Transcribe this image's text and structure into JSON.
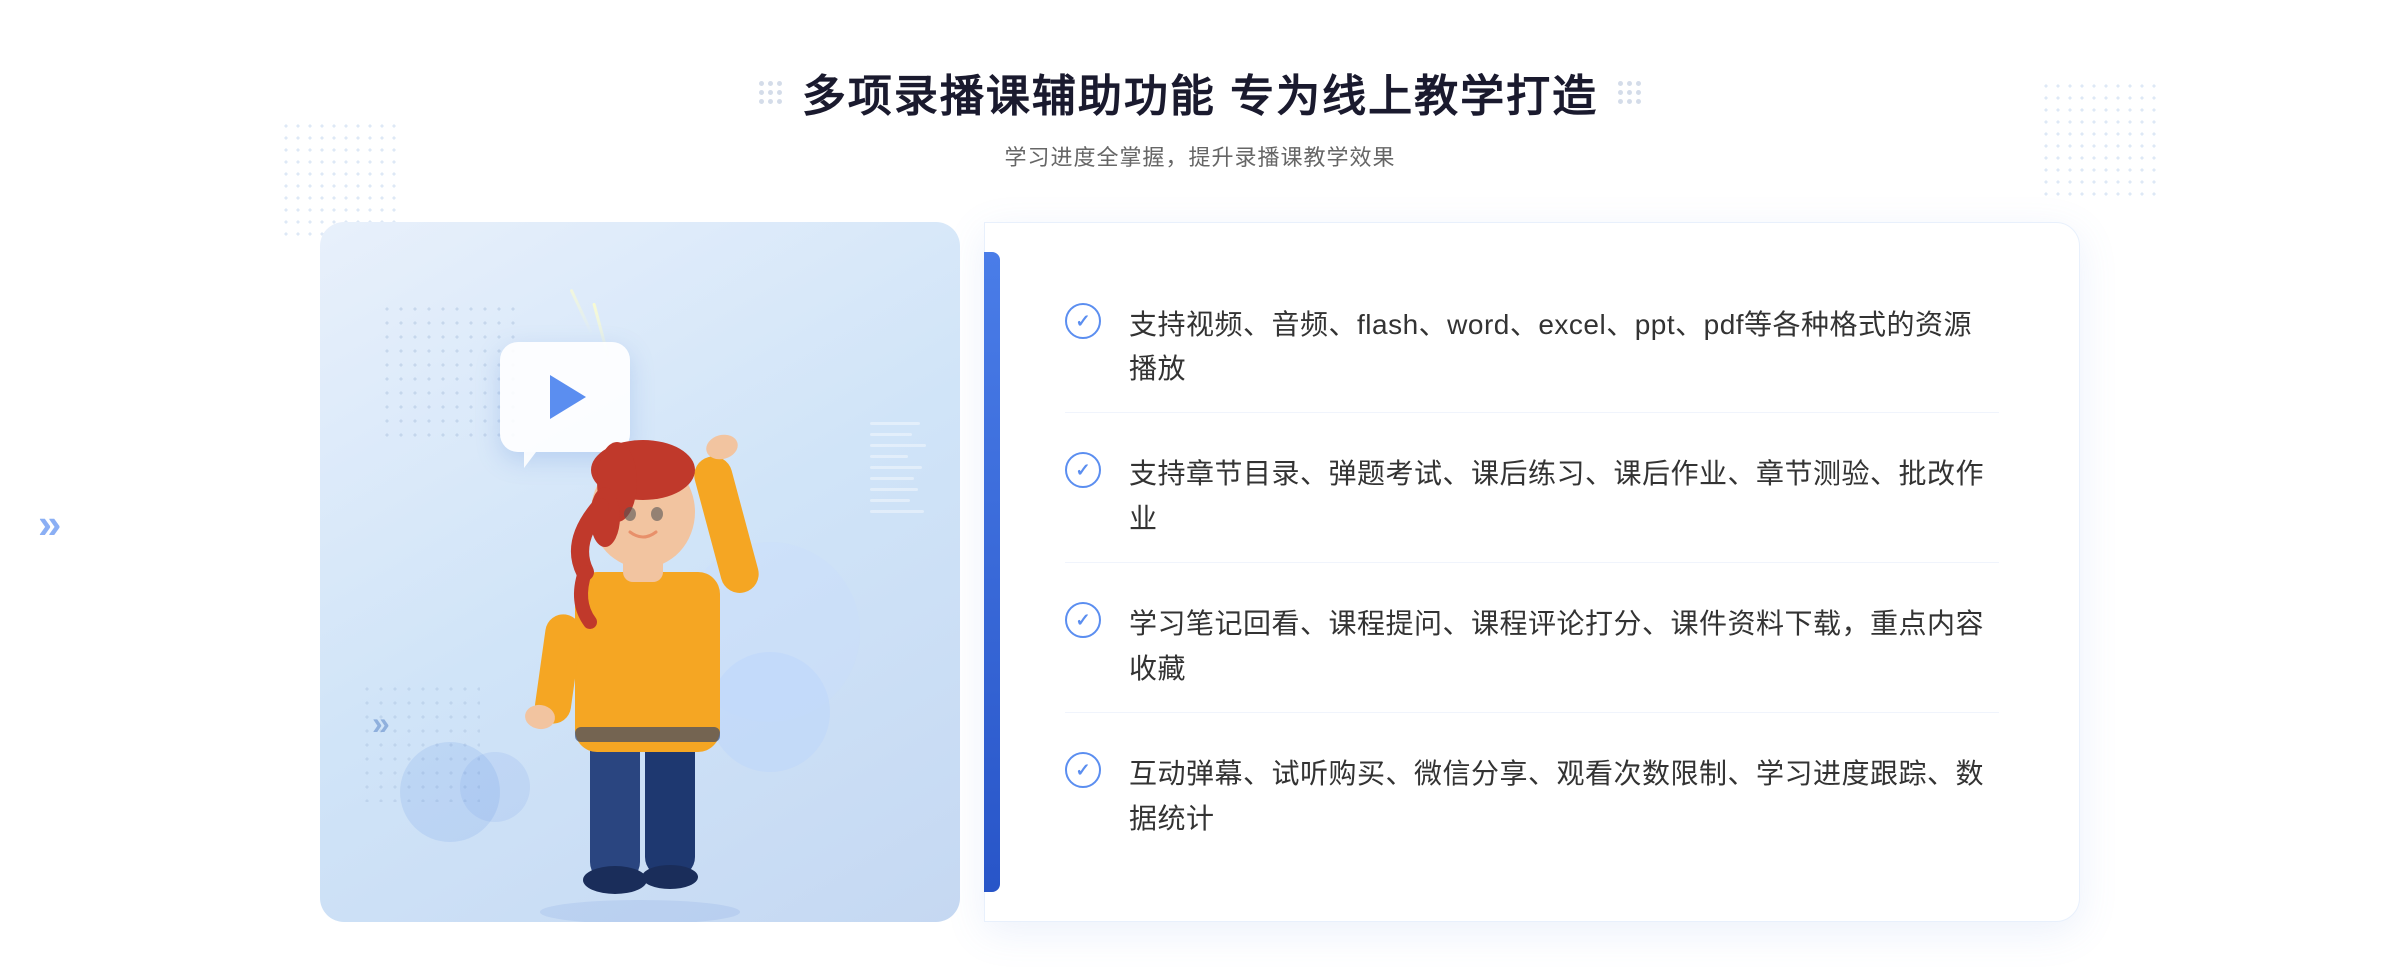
{
  "header": {
    "title": "多项录播课辅助功能 专为线上教学打造",
    "subtitle": "学习进度全掌握，提升录播课教学效果"
  },
  "features": [
    {
      "id": "feature-1",
      "text": "支持视频、音频、flash、word、excel、ppt、pdf等各种格式的资源播放"
    },
    {
      "id": "feature-2",
      "text": "支持章节目录、弹题考试、课后练习、课后作业、章节测验、批改作业"
    },
    {
      "id": "feature-3",
      "text": "学习笔记回看、课程提问、课程评论打分、课件资料下载，重点内容收藏"
    },
    {
      "id": "feature-4",
      "text": "互动弹幕、试听购买、微信分享、观看次数限制、学习进度跟踪、数据统计"
    }
  ],
  "decorations": {
    "chevrons_left": "»",
    "check_mark": "✓"
  }
}
